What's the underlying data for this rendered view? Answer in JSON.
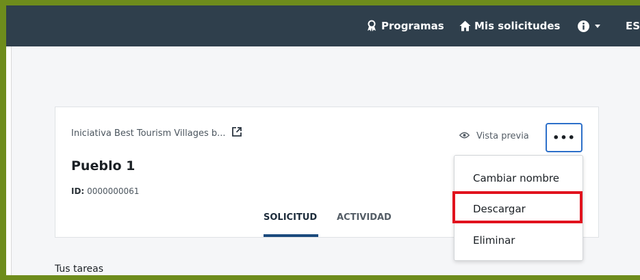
{
  "nav": {
    "programs_label": "Programas",
    "requests_label": "Mis solicitudes",
    "language_label": "ES"
  },
  "card": {
    "program_link": "Iniciativa Best Tourism Villages b...",
    "title": "Pueblo 1",
    "id_label": "ID:",
    "id_value": "0000000061",
    "preview_label": "Vista previa",
    "more_label": "•••",
    "tabs": [
      {
        "label": "SOLICITUD",
        "active": true
      },
      {
        "label": "ACTIVIDAD",
        "active": false
      }
    ]
  },
  "menu": {
    "items": [
      {
        "label": "Cambiar nombre"
      },
      {
        "label": "Descargar",
        "highlighted": true
      },
      {
        "label": "Eliminar"
      }
    ]
  },
  "tasks_heading": "Tus tareas",
  "colors": {
    "topbar": "#2f3f4c",
    "tab_active": "#1b4a7d",
    "button_border": "#2c6fc9",
    "highlight": "#e1121d",
    "frame": "#6e8c1c"
  },
  "icons": {
    "programs": "award-icon",
    "requests": "home-icon",
    "info": "info-icon",
    "external": "external-link-icon",
    "preview": "eye-icon"
  }
}
